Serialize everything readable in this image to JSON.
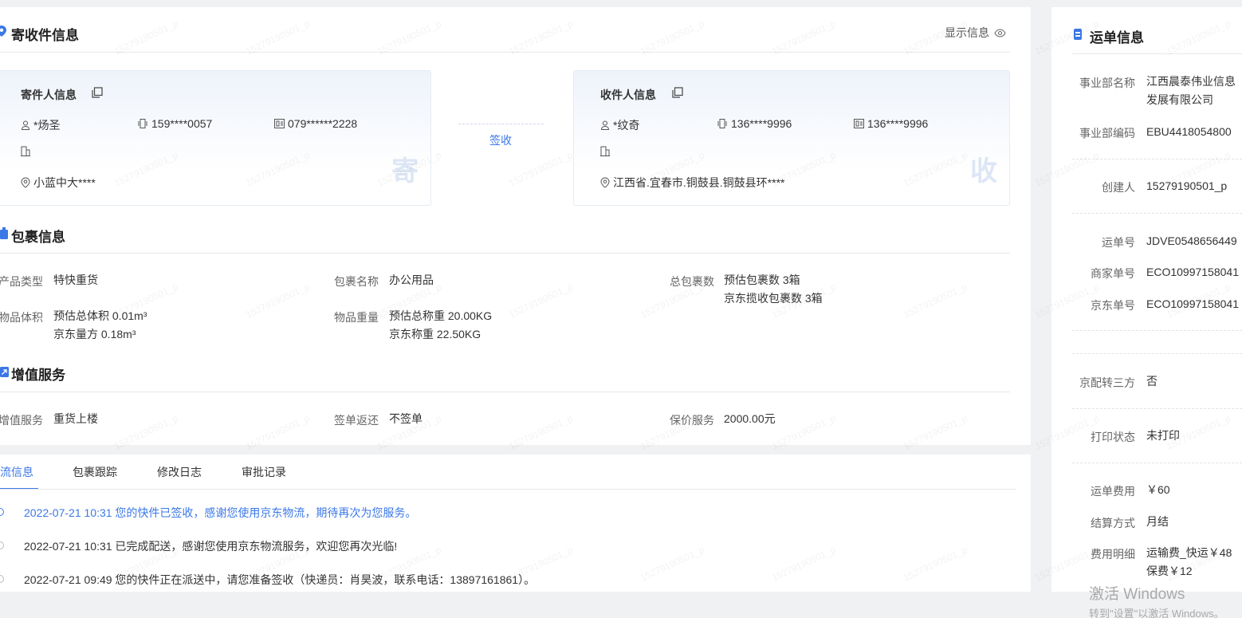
{
  "sender_receiver": {
    "title": "寄收件信息",
    "show_info_label": "显示信息",
    "sender": {
      "title": "寄件人信息",
      "name": "*炀圣",
      "mobile": "159****0057",
      "phone": "079******2228",
      "company": "",
      "address": "小蓝中大****",
      "watermark_char": "寄"
    },
    "sign_label": "签收",
    "receiver": {
      "title": "收件人信息",
      "name": "*纹奇",
      "mobile": "136****9996",
      "phone": "136****9996",
      "company": "",
      "address": "江西省.宜春市.铜鼓县.铜鼓县环****",
      "watermark_char": "收"
    }
  },
  "package": {
    "title": "包裹信息",
    "product_type_label": "产品类型",
    "product_type": "特快重货",
    "package_name_label": "包裹名称",
    "package_name": "办公用品",
    "total_count_label": "总包裹数",
    "total_count_est": "预估包裹数 3箱",
    "total_count_jd": "京东揽收包裹数 3箱",
    "volume_label": "物品体积",
    "volume_est": "预估总体积 0.01m³",
    "volume_jd": "京东量方 0.18m³",
    "weight_label": "物品重量",
    "weight_est": "预估总称重 20.00KG",
    "weight_jd": "京东称重 22.50KG"
  },
  "value_added": {
    "title": "增值服务",
    "service_label": "增值服务",
    "service": "重货上楼",
    "return_label": "签单返还",
    "return": "不签单",
    "insure_label": "保价服务",
    "insure": "2000.00元"
  },
  "tabs": [
    {
      "label": "物流信息"
    },
    {
      "label": "包裹跟踪"
    },
    {
      "label": "修改日志"
    },
    {
      "label": "审批记录"
    }
  ],
  "logs": [
    {
      "text": "2022-07-21 10:31 您的快件已签收，感谢您使用京东物流，期待再次为您服务。",
      "color": "#3b78e7"
    },
    {
      "text": "2022-07-21 10:31 已完成配送，感谢您使用京东物流服务，欢迎您再次光临!",
      "color": "#333333"
    },
    {
      "text": "2022-07-21 09:49 您的快件正在派送中，请您准备签收（快递员：肖昊波，联系电话：13897161861）。",
      "color": "#333333"
    }
  ],
  "waybill": {
    "title": "运单信息",
    "dept_name_label": "事业部名称",
    "dept_name_1": "江西晨泰伟业信息",
    "dept_name_2": "发展有限公司",
    "dept_code_label": "事业部编码",
    "dept_code": "EBU4418054800",
    "creator_label": "创建人",
    "creator": "15279190501_p",
    "waybill_no_label": "运单号",
    "waybill_no": "JDVE0548656449",
    "merchant_no_label": "商家单号",
    "merchant_no": "ECO10997158041",
    "jd_no_label": "京东单号",
    "jd_no": "ECO10997158041",
    "third_party_label": "京配转三方",
    "third_party": "否",
    "print_status_label": "打印状态",
    "print_status": "未打印",
    "fee_label": "运单费用",
    "fee": "￥60",
    "settle_label": "结算方式",
    "settle": "月结",
    "fee_detail_label": "费用明细",
    "fee_detail_1": "运输费_快运￥48",
    "fee_detail_2": "保费￥12"
  },
  "watermark_text": "15279190501_p",
  "windows_activation": {
    "line1": "激活 Windows",
    "line2": "转到\"设置\"以激活 Windows。"
  },
  "colors": {
    "accent": "#3b78e7",
    "background": "#f0f1f3"
  }
}
